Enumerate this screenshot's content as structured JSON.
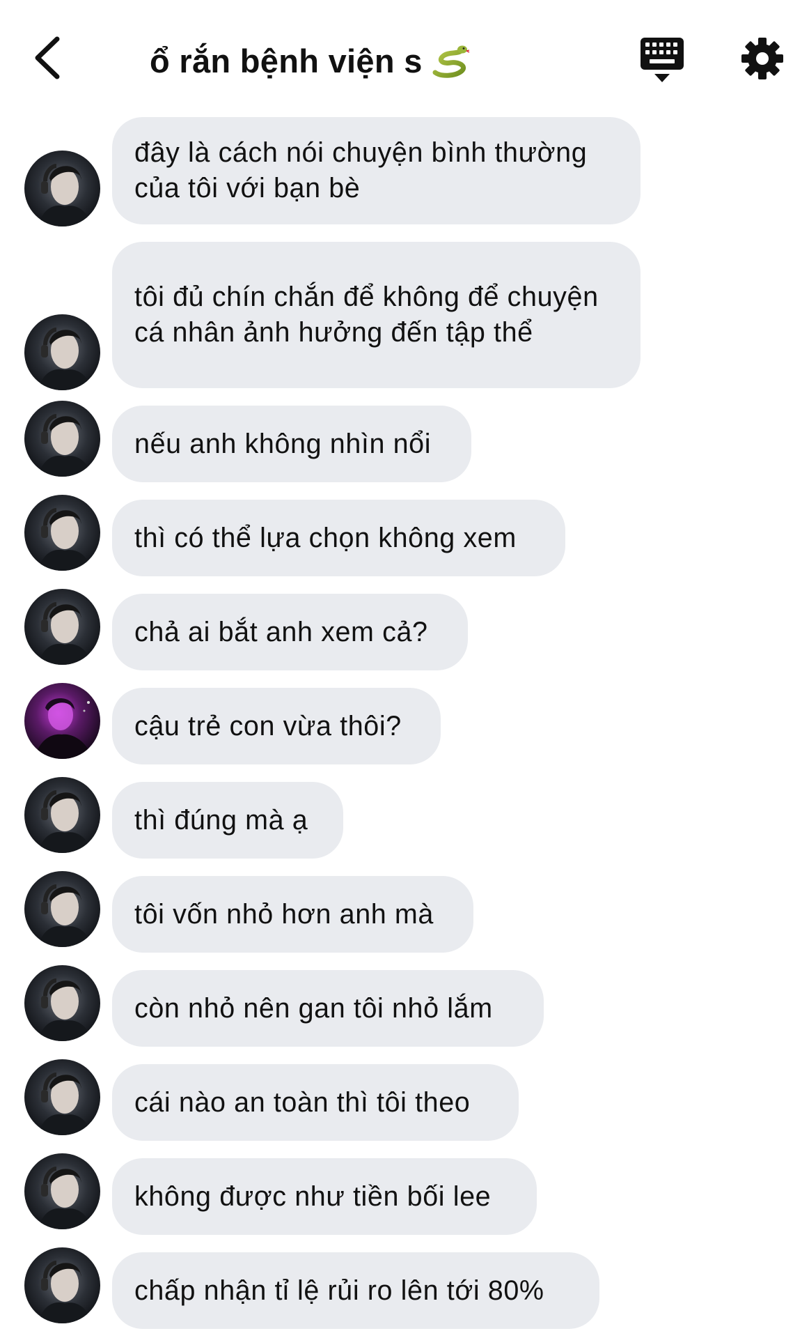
{
  "header": {
    "title": "ổ rắn bệnh viện s",
    "back_icon": "chevron-left-icon",
    "keyboard_icon": "keyboard-icon",
    "settings_icon": "gear-icon",
    "title_emoji": "snake-icon"
  },
  "colors": {
    "bubble_bg": "#e9ebef",
    "text": "#111111",
    "background": "#ffffff"
  },
  "messages": [
    {
      "avatar": "avatar-user-a",
      "text": "đây là cách nói chuyện bình thường của tôi với bạn bè"
    },
    {
      "avatar": "avatar-user-a",
      "text": "tôi đủ chín chắn để không để chuyện cá nhân ảnh hưởng đến tập thể"
    },
    {
      "avatar": "avatar-user-a",
      "text": "nếu anh không nhìn nổi"
    },
    {
      "avatar": "avatar-user-a",
      "text": "thì có thể lựa chọn không xem"
    },
    {
      "avatar": "avatar-user-a",
      "text": "chả ai bắt anh xem cả?"
    },
    {
      "avatar": "avatar-user-b",
      "text": "cậu trẻ con vừa thôi?"
    },
    {
      "avatar": "avatar-user-a",
      "text": "thì đúng mà ạ"
    },
    {
      "avatar": "avatar-user-a",
      "text": "tôi vốn nhỏ hơn anh mà"
    },
    {
      "avatar": "avatar-user-a",
      "text": "còn nhỏ nên gan tôi nhỏ lắm"
    },
    {
      "avatar": "avatar-user-a",
      "text": "cái nào an toàn thì tôi theo"
    },
    {
      "avatar": "avatar-user-a",
      "text": "không được như tiền bối lee"
    },
    {
      "avatar": "avatar-user-a",
      "text": "chấp nhận tỉ lệ rủi ro lên tới 80%"
    }
  ]
}
